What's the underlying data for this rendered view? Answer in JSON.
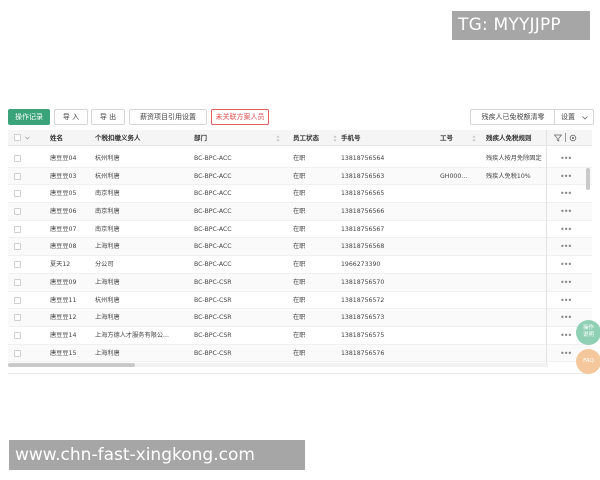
{
  "watermark_top": "TG: MYYJJPP",
  "watermark_bottom": "www.chn-fast-xingkong.com",
  "toolbar": {
    "op_log": "操作记录",
    "import": "导 入",
    "export": "导 出",
    "salary_ref": "薪资项目引用设置",
    "unrelated": "未关联方案人员",
    "disabled_clear": "残疾人已免税额清零",
    "settings": "设置"
  },
  "columns": {
    "name": "姓名",
    "agent": "个税扣缴义务人",
    "dept": "部门",
    "status": "员工状态",
    "phone": "手机号",
    "jobno": "工号",
    "rule": "残疾人免税规则"
  },
  "rows": [
    {
      "name": "唐豆豆04",
      "agent": "杭州利唐",
      "dept": "BC-BPC-ACC",
      "status": "在职",
      "phone": "13818756564",
      "jobno": "",
      "rule": "残疾人按月免除固定"
    },
    {
      "name": "唐豆豆03",
      "agent": "杭州利唐",
      "dept": "BC-BPC-ACC",
      "status": "在职",
      "phone": "13818756563",
      "jobno": "GH000...",
      "rule": "残疾人免税10%"
    },
    {
      "name": "唐豆豆05",
      "agent": "南京利唐",
      "dept": "BC-BPC-ACC",
      "status": "在职",
      "phone": "13818756565",
      "jobno": "",
      "rule": ""
    },
    {
      "name": "唐豆豆06",
      "agent": "南京利唐",
      "dept": "BC-BPC-ACC",
      "status": "在职",
      "phone": "13818756566",
      "jobno": "",
      "rule": ""
    },
    {
      "name": "唐豆豆07",
      "agent": "南京利唐",
      "dept": "BC-BPC-ACC",
      "status": "在职",
      "phone": "13818756567",
      "jobno": "",
      "rule": ""
    },
    {
      "name": "唐豆豆08",
      "agent": "上海利唐",
      "dept": "BC-BPC-ACC",
      "status": "在职",
      "phone": "13818756568",
      "jobno": "",
      "rule": ""
    },
    {
      "name": "夏天12",
      "agent": "分公司",
      "dept": "BC-BPC-ACC",
      "status": "在职",
      "phone": "1966273390",
      "jobno": "",
      "rule": ""
    },
    {
      "name": "唐豆豆09",
      "agent": "上海利唐",
      "dept": "BC-BPC-CSR",
      "status": "在职",
      "phone": "13818756570",
      "jobno": "",
      "rule": ""
    },
    {
      "name": "唐豆豆11",
      "agent": "杭州利唐",
      "dept": "BC-BPC-CSR",
      "status": "在职",
      "phone": "13818756572",
      "jobno": "",
      "rule": ""
    },
    {
      "name": "唐豆豆12",
      "agent": "上海利唐",
      "dept": "BC-BPC-CSR",
      "status": "在职",
      "phone": "13818756573",
      "jobno": "",
      "rule": ""
    },
    {
      "name": "唐豆豆14",
      "agent": "上海方德人才服务有限公...",
      "dept": "BC-BPC-CSR",
      "status": "在职",
      "phone": "13818756575",
      "jobno": "",
      "rule": ""
    },
    {
      "name": "唐豆豆15",
      "agent": "上海利唐",
      "dept": "BC-BPC-CSR",
      "status": "在职",
      "phone": "13818756576",
      "jobno": "",
      "rule": ""
    }
  ],
  "row_more": "•••",
  "fab_ops": "操作\n说明",
  "fab_faq": "FAQ"
}
